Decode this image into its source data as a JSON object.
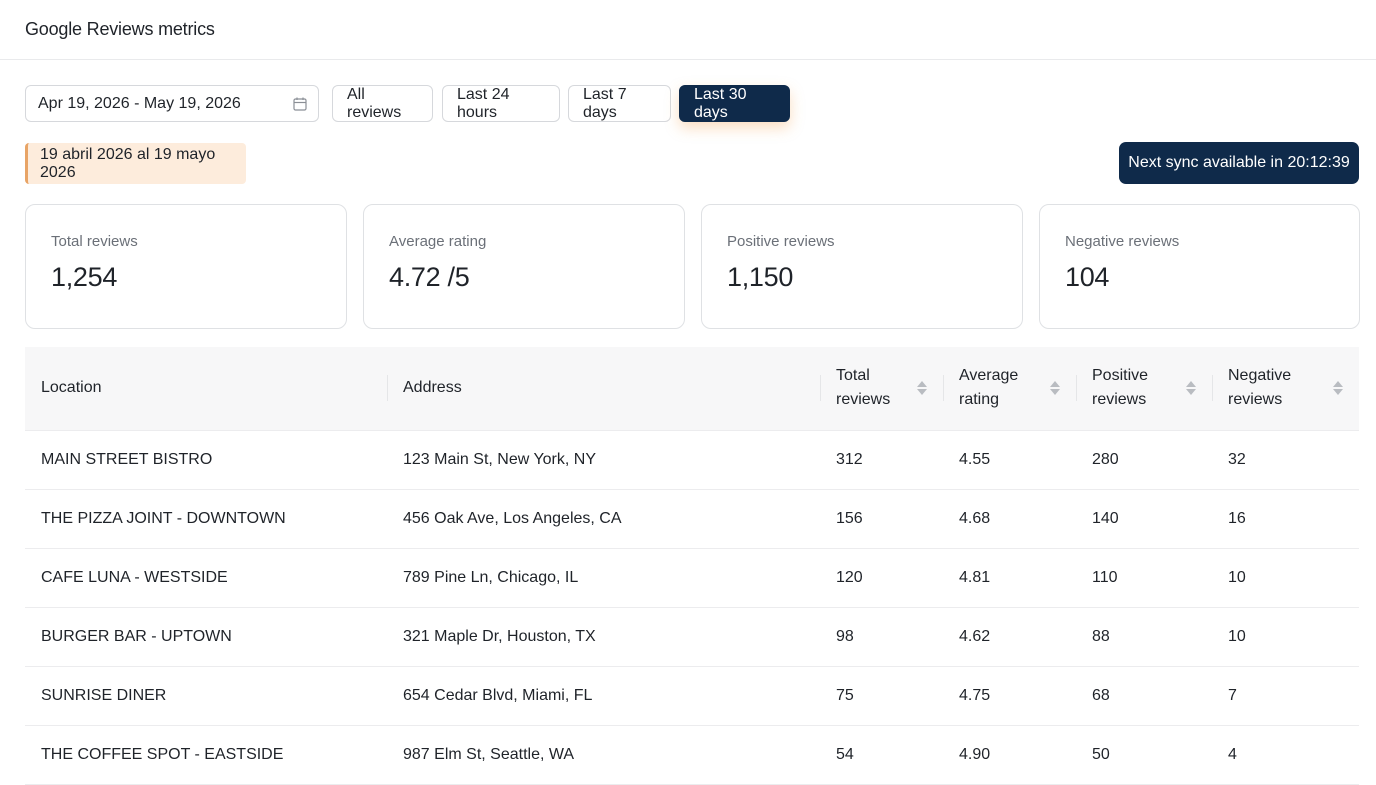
{
  "header": {
    "title": "Google Reviews metrics"
  },
  "controls": {
    "date_range": "Apr 19, 2026 - May 19, 2026",
    "filters": [
      "All reviews",
      "Last 24 hours",
      "Last 7 days",
      "Last 30 days"
    ],
    "active_filter": "Last 30 days"
  },
  "range_note": "19 abril 2026 al 19 mayo 2026",
  "sync_button": "Next sync available in 20:12:39",
  "cards": [
    {
      "label": "Total reviews",
      "value": "1,254"
    },
    {
      "label": "Average rating",
      "value": "4.72 /5"
    },
    {
      "label": "Positive reviews",
      "value": "1,150"
    },
    {
      "label": "Negative reviews",
      "value": "104"
    }
  ],
  "table": {
    "columns": [
      "Location",
      "Address",
      "Total reviews",
      "Average rating",
      "Positive reviews",
      "Negative reviews"
    ],
    "rows": [
      [
        "MAIN STREET BISTRO",
        "123 Main St, New York, NY",
        "312",
        "4.55",
        "280",
        "32"
      ],
      [
        "THE PIZZA JOINT - DOWNTOWN",
        "456 Oak Ave, Los Angeles, CA",
        "156",
        "4.68",
        "140",
        "16"
      ],
      [
        "CAFE LUNA - WESTSIDE",
        "789 Pine Ln, Chicago, IL",
        "120",
        "4.81",
        "110",
        "10"
      ],
      [
        "BURGER BAR - UPTOWN",
        "321 Maple Dr, Houston, TX",
        "98",
        "4.62",
        "88",
        "10"
      ],
      [
        "SUNRISE DINER",
        "654 Cedar Blvd, Miami, FL",
        "75",
        "4.75",
        "68",
        "7"
      ],
      [
        "THE COFFEE SPOT - EASTSIDE",
        "987 Elm St, Seattle, WA",
        "54",
        "4.90",
        "50",
        "4"
      ]
    ]
  },
  "colors": {
    "primary": "#0f2a4a",
    "note_bg": "#fdecdc",
    "note_accent": "#e8a466"
  },
  "icons": {
    "date_picker": "calendar-icon",
    "sort": "sort-icon"
  }
}
